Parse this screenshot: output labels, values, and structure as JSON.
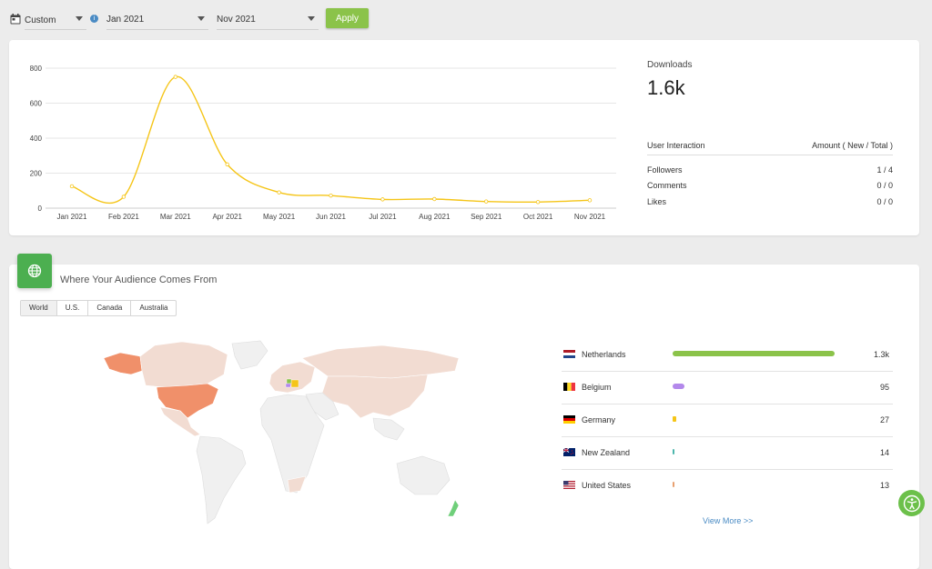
{
  "filters": {
    "range_label": "Custom",
    "start_month": "Jan 2021",
    "end_month": "Nov 2021",
    "apply_label": "Apply"
  },
  "chart_data": {
    "type": "line",
    "categories": [
      "Jan 2021",
      "Feb 2021",
      "Mar 2021",
      "Apr 2021",
      "May 2021",
      "Jun 2021",
      "Jul 2021",
      "Aug 2021",
      "Sep 2021",
      "Oct 2021",
      "Nov 2021"
    ],
    "values": [
      125,
      65,
      750,
      250,
      90,
      72,
      50,
      52,
      38,
      35,
      45
    ],
    "yticks": [
      "0",
      "200",
      "400",
      "600",
      "800"
    ],
    "ylim": [
      0,
      800
    ],
    "grid": true,
    "color": "#f5c518"
  },
  "stats": {
    "downloads_label": "Downloads",
    "downloads_value": "1.6k",
    "col_interaction": "User Interaction",
    "col_amount": "Amount ( New / Total )",
    "rows": [
      {
        "label": "Followers",
        "value": "1 / 4"
      },
      {
        "label": "Comments",
        "value": "0 / 0"
      },
      {
        "label": "Likes",
        "value": "0 / 0"
      }
    ]
  },
  "audience": {
    "title": "Where Your Audience Comes From",
    "tabs": [
      "World",
      "U.S.",
      "Canada",
      "Australia"
    ],
    "active_tab": "World",
    "countries": [
      {
        "name": "Netherlands",
        "value": "1.3k",
        "share": 1.0,
        "color": "#8bc34a"
      },
      {
        "name": "Belgium",
        "value": "95",
        "share": 0.073,
        "color": "#b388eb"
      },
      {
        "name": "Germany",
        "value": "27",
        "share": 0.021,
        "color": "#f5c518"
      },
      {
        "name": "New Zealand",
        "value": "14",
        "share": 0.011,
        "color": "#4db6ac"
      },
      {
        "name": "United States",
        "value": "13",
        "share": 0.01,
        "color": "#e8a070"
      }
    ],
    "view_more": "View More >>"
  },
  "colors": {
    "accent": "#8bc34a",
    "link": "#4a8bc4",
    "map_high": "#f0906a",
    "map_low": "#f2dcd2",
    "map_none": "#f0f0f0"
  }
}
